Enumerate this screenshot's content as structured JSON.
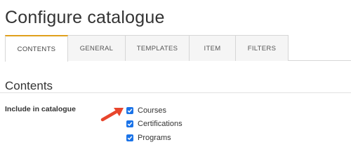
{
  "page": {
    "title": "Configure catalogue"
  },
  "tabs": [
    {
      "label": "CONTENTS",
      "active": true
    },
    {
      "label": "GENERAL",
      "active": false
    },
    {
      "label": "TEMPLATES",
      "active": false
    },
    {
      "label": "ITEM",
      "active": false
    },
    {
      "label": "FILTERS",
      "active": false
    }
  ],
  "section": {
    "title": "Contents"
  },
  "include_field": {
    "label": "Include in catalogue",
    "options": [
      {
        "label": "Courses",
        "checked": true
      },
      {
        "label": "Certifications",
        "checked": true
      },
      {
        "label": "Programs",
        "checked": true
      }
    ]
  },
  "colors": {
    "accent_tab": "#e0a01c",
    "checkbox": "#1a73e8",
    "arrow": "#e8452c"
  }
}
